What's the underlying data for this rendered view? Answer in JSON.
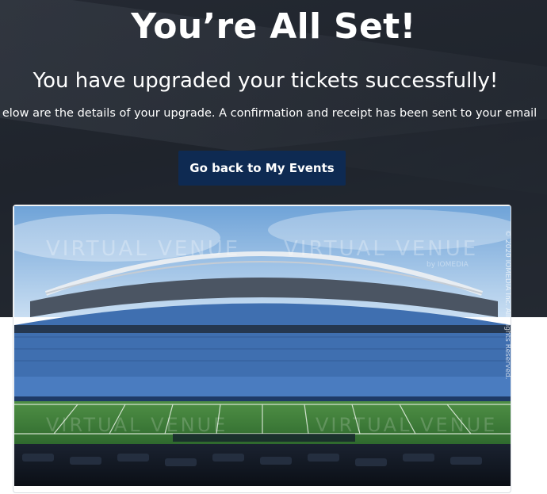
{
  "header": {
    "title": "You’re All Set!",
    "subtitle": "You have upgraded your tickets successfully!",
    "details": "elow are the details of your upgrade. A confirmation and receipt has been sent to your email"
  },
  "actions": {
    "back_label": "Go back to My Events"
  },
  "venue_image": {
    "watermark_brand": "VIRTUAL VENUE",
    "watermark_sub": "by IOMEDIA",
    "copyright": "© 2020 IOMEDIA Inc. All Rights Reserved."
  },
  "colors": {
    "hero_bg": "#22272f",
    "button_bg": "#0e2a52",
    "sky": "#8db8e3",
    "seats": "#3f6fb0",
    "field": "#3c7a3a"
  }
}
